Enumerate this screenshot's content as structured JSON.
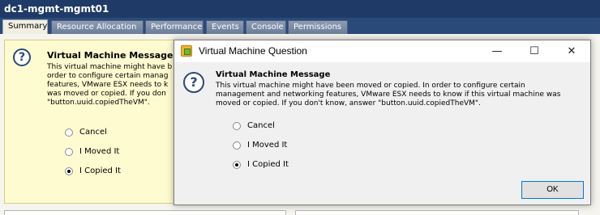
{
  "window": {
    "title": "dc1-mgmt-mgmt01"
  },
  "tabs": [
    {
      "label": "Summary",
      "active": true
    },
    {
      "label": "Resource Allocation",
      "active": false
    },
    {
      "label": "Performance",
      "active": false
    },
    {
      "label": "Events",
      "active": false
    },
    {
      "label": "Console",
      "active": false
    },
    {
      "label": "Permissions",
      "active": false
    }
  ],
  "background_message": {
    "title": "Virtual Machine Message",
    "text": "This virtual machine might have b\norder to configure certain manag\nfeatures, VMware ESX needs to k\nwas moved or copied. If you don\n\"button.uuid.copiedTheVM\".",
    "options": [
      {
        "label": "Cancel",
        "selected": false
      },
      {
        "label": "I Moved It",
        "selected": false
      },
      {
        "label": "I Copied It",
        "selected": true
      }
    ]
  },
  "dialog": {
    "title": "Virtual Machine Question",
    "controls": {
      "minimize": "—",
      "maximize": "☐",
      "close": "✕"
    },
    "heading": "Virtual Machine Message",
    "message": "This virtual machine might have been moved or copied. In order to configure certain\nmanagement and networking features, VMware ESX needs to know if this virtual machine was\nmoved or copied. If you don't know, answer \"button.uuid.copiedTheVM\".",
    "options": [
      {
        "label": "Cancel",
        "selected": false
      },
      {
        "label": "I Moved It",
        "selected": false
      },
      {
        "label": "I Copied It",
        "selected": true
      }
    ],
    "ok_label": "OK"
  },
  "colors": {
    "title_bar": "#1f3a66",
    "message_bg": "#fffbd0",
    "accent_border": "#0078d7"
  },
  "icons": {
    "question": "?"
  }
}
